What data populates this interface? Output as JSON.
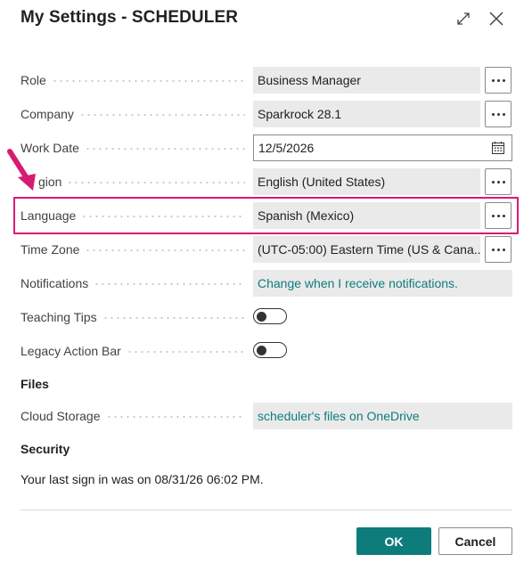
{
  "dialog": {
    "title": "My Settings - SCHEDULER",
    "icons": {
      "expand": "expand-icon",
      "close": "close-icon"
    }
  },
  "settings": {
    "role": {
      "label": "Role",
      "value": "Business Manager"
    },
    "company": {
      "label": "Company",
      "value": "Sparkrock 28.1"
    },
    "work_date": {
      "label": "Work Date",
      "value": "12/5/2026"
    },
    "region": {
      "label": "Region",
      "visible_label": "gion",
      "value": "English (United States)"
    },
    "language": {
      "label": "Language",
      "value": "Spanish (Mexico)"
    },
    "time_zone": {
      "label": "Time Zone",
      "value": "(UTC-05:00) Eastern Time (US & Cana..."
    },
    "notifications": {
      "label": "Notifications",
      "value": "Change when I receive notifications."
    },
    "teaching_tips": {
      "label": "Teaching Tips",
      "enabled": false
    },
    "legacy_action_bar": {
      "label": "Legacy Action Bar",
      "enabled": false
    }
  },
  "files": {
    "heading": "Files",
    "cloud_storage": {
      "label": "Cloud Storage",
      "value": "scheduler's files on OneDrive"
    }
  },
  "security": {
    "heading": "Security",
    "last_sign_in": "Your last sign in was on 08/31/26 06:02 PM."
  },
  "buttons": {
    "ok": "OK",
    "cancel": "Cancel"
  },
  "colors": {
    "accent": "#0f7c7c",
    "highlight": "#d81b72",
    "field_bg": "#eaeaea"
  }
}
